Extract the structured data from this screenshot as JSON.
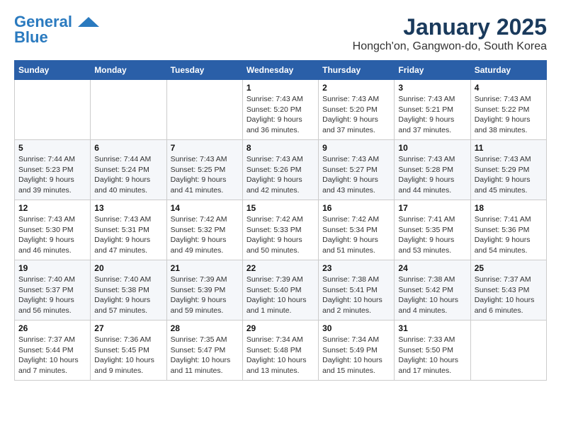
{
  "header": {
    "logo_line1": "General",
    "logo_line2": "Blue",
    "main_title": "January 2025",
    "subtitle": "Hongch'on, Gangwon-do, South Korea"
  },
  "days_of_week": [
    "Sunday",
    "Monday",
    "Tuesday",
    "Wednesday",
    "Thursday",
    "Friday",
    "Saturday"
  ],
  "weeks": [
    [
      {
        "day": "",
        "info": ""
      },
      {
        "day": "",
        "info": ""
      },
      {
        "day": "",
        "info": ""
      },
      {
        "day": "1",
        "info": "Sunrise: 7:43 AM\nSunset: 5:20 PM\nDaylight: 9 hours\nand 36 minutes."
      },
      {
        "day": "2",
        "info": "Sunrise: 7:43 AM\nSunset: 5:20 PM\nDaylight: 9 hours\nand 37 minutes."
      },
      {
        "day": "3",
        "info": "Sunrise: 7:43 AM\nSunset: 5:21 PM\nDaylight: 9 hours\nand 37 minutes."
      },
      {
        "day": "4",
        "info": "Sunrise: 7:43 AM\nSunset: 5:22 PM\nDaylight: 9 hours\nand 38 minutes."
      }
    ],
    [
      {
        "day": "5",
        "info": "Sunrise: 7:44 AM\nSunset: 5:23 PM\nDaylight: 9 hours\nand 39 minutes."
      },
      {
        "day": "6",
        "info": "Sunrise: 7:44 AM\nSunset: 5:24 PM\nDaylight: 9 hours\nand 40 minutes."
      },
      {
        "day": "7",
        "info": "Sunrise: 7:43 AM\nSunset: 5:25 PM\nDaylight: 9 hours\nand 41 minutes."
      },
      {
        "day": "8",
        "info": "Sunrise: 7:43 AM\nSunset: 5:26 PM\nDaylight: 9 hours\nand 42 minutes."
      },
      {
        "day": "9",
        "info": "Sunrise: 7:43 AM\nSunset: 5:27 PM\nDaylight: 9 hours\nand 43 minutes."
      },
      {
        "day": "10",
        "info": "Sunrise: 7:43 AM\nSunset: 5:28 PM\nDaylight: 9 hours\nand 44 minutes."
      },
      {
        "day": "11",
        "info": "Sunrise: 7:43 AM\nSunset: 5:29 PM\nDaylight: 9 hours\nand 45 minutes."
      }
    ],
    [
      {
        "day": "12",
        "info": "Sunrise: 7:43 AM\nSunset: 5:30 PM\nDaylight: 9 hours\nand 46 minutes."
      },
      {
        "day": "13",
        "info": "Sunrise: 7:43 AM\nSunset: 5:31 PM\nDaylight: 9 hours\nand 47 minutes."
      },
      {
        "day": "14",
        "info": "Sunrise: 7:42 AM\nSunset: 5:32 PM\nDaylight: 9 hours\nand 49 minutes."
      },
      {
        "day": "15",
        "info": "Sunrise: 7:42 AM\nSunset: 5:33 PM\nDaylight: 9 hours\nand 50 minutes."
      },
      {
        "day": "16",
        "info": "Sunrise: 7:42 AM\nSunset: 5:34 PM\nDaylight: 9 hours\nand 51 minutes."
      },
      {
        "day": "17",
        "info": "Sunrise: 7:41 AM\nSunset: 5:35 PM\nDaylight: 9 hours\nand 53 minutes."
      },
      {
        "day": "18",
        "info": "Sunrise: 7:41 AM\nSunset: 5:36 PM\nDaylight: 9 hours\nand 54 minutes."
      }
    ],
    [
      {
        "day": "19",
        "info": "Sunrise: 7:40 AM\nSunset: 5:37 PM\nDaylight: 9 hours\nand 56 minutes."
      },
      {
        "day": "20",
        "info": "Sunrise: 7:40 AM\nSunset: 5:38 PM\nDaylight: 9 hours\nand 57 minutes."
      },
      {
        "day": "21",
        "info": "Sunrise: 7:39 AM\nSunset: 5:39 PM\nDaylight: 9 hours\nand 59 minutes."
      },
      {
        "day": "22",
        "info": "Sunrise: 7:39 AM\nSunset: 5:40 PM\nDaylight: 10 hours\nand 1 minute."
      },
      {
        "day": "23",
        "info": "Sunrise: 7:38 AM\nSunset: 5:41 PM\nDaylight: 10 hours\nand 2 minutes."
      },
      {
        "day": "24",
        "info": "Sunrise: 7:38 AM\nSunset: 5:42 PM\nDaylight: 10 hours\nand 4 minutes."
      },
      {
        "day": "25",
        "info": "Sunrise: 7:37 AM\nSunset: 5:43 PM\nDaylight: 10 hours\nand 6 minutes."
      }
    ],
    [
      {
        "day": "26",
        "info": "Sunrise: 7:37 AM\nSunset: 5:44 PM\nDaylight: 10 hours\nand 7 minutes."
      },
      {
        "day": "27",
        "info": "Sunrise: 7:36 AM\nSunset: 5:45 PM\nDaylight: 10 hours\nand 9 minutes."
      },
      {
        "day": "28",
        "info": "Sunrise: 7:35 AM\nSunset: 5:47 PM\nDaylight: 10 hours\nand 11 minutes."
      },
      {
        "day": "29",
        "info": "Sunrise: 7:34 AM\nSunset: 5:48 PM\nDaylight: 10 hours\nand 13 minutes."
      },
      {
        "day": "30",
        "info": "Sunrise: 7:34 AM\nSunset: 5:49 PM\nDaylight: 10 hours\nand 15 minutes."
      },
      {
        "day": "31",
        "info": "Sunrise: 7:33 AM\nSunset: 5:50 PM\nDaylight: 10 hours\nand 17 minutes."
      },
      {
        "day": "",
        "info": ""
      }
    ]
  ]
}
